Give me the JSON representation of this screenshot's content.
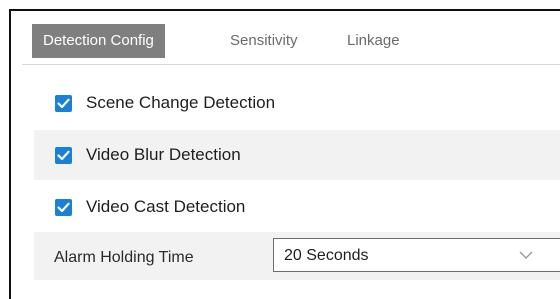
{
  "tabs": [
    {
      "label": "Detection Config",
      "active": true
    },
    {
      "label": "Sensitivity",
      "active": false
    },
    {
      "label": "Linkage",
      "active": false
    }
  ],
  "options": [
    {
      "label": "Scene Change Detection",
      "checked": true
    },
    {
      "label": "Video Blur Detection",
      "checked": true
    },
    {
      "label": "Video Cast Detection",
      "checked": true
    }
  ],
  "alarm": {
    "label": "Alarm Holding Time",
    "selected_value": "20 Seconds"
  },
  "colors": {
    "checkbox": "#1a7fd6",
    "active_tab": "#7f7f7f",
    "row_shade": "#f2f2f2"
  },
  "icons": {
    "checkbox": "check-icon",
    "dropdown": "chevron-down-icon"
  }
}
